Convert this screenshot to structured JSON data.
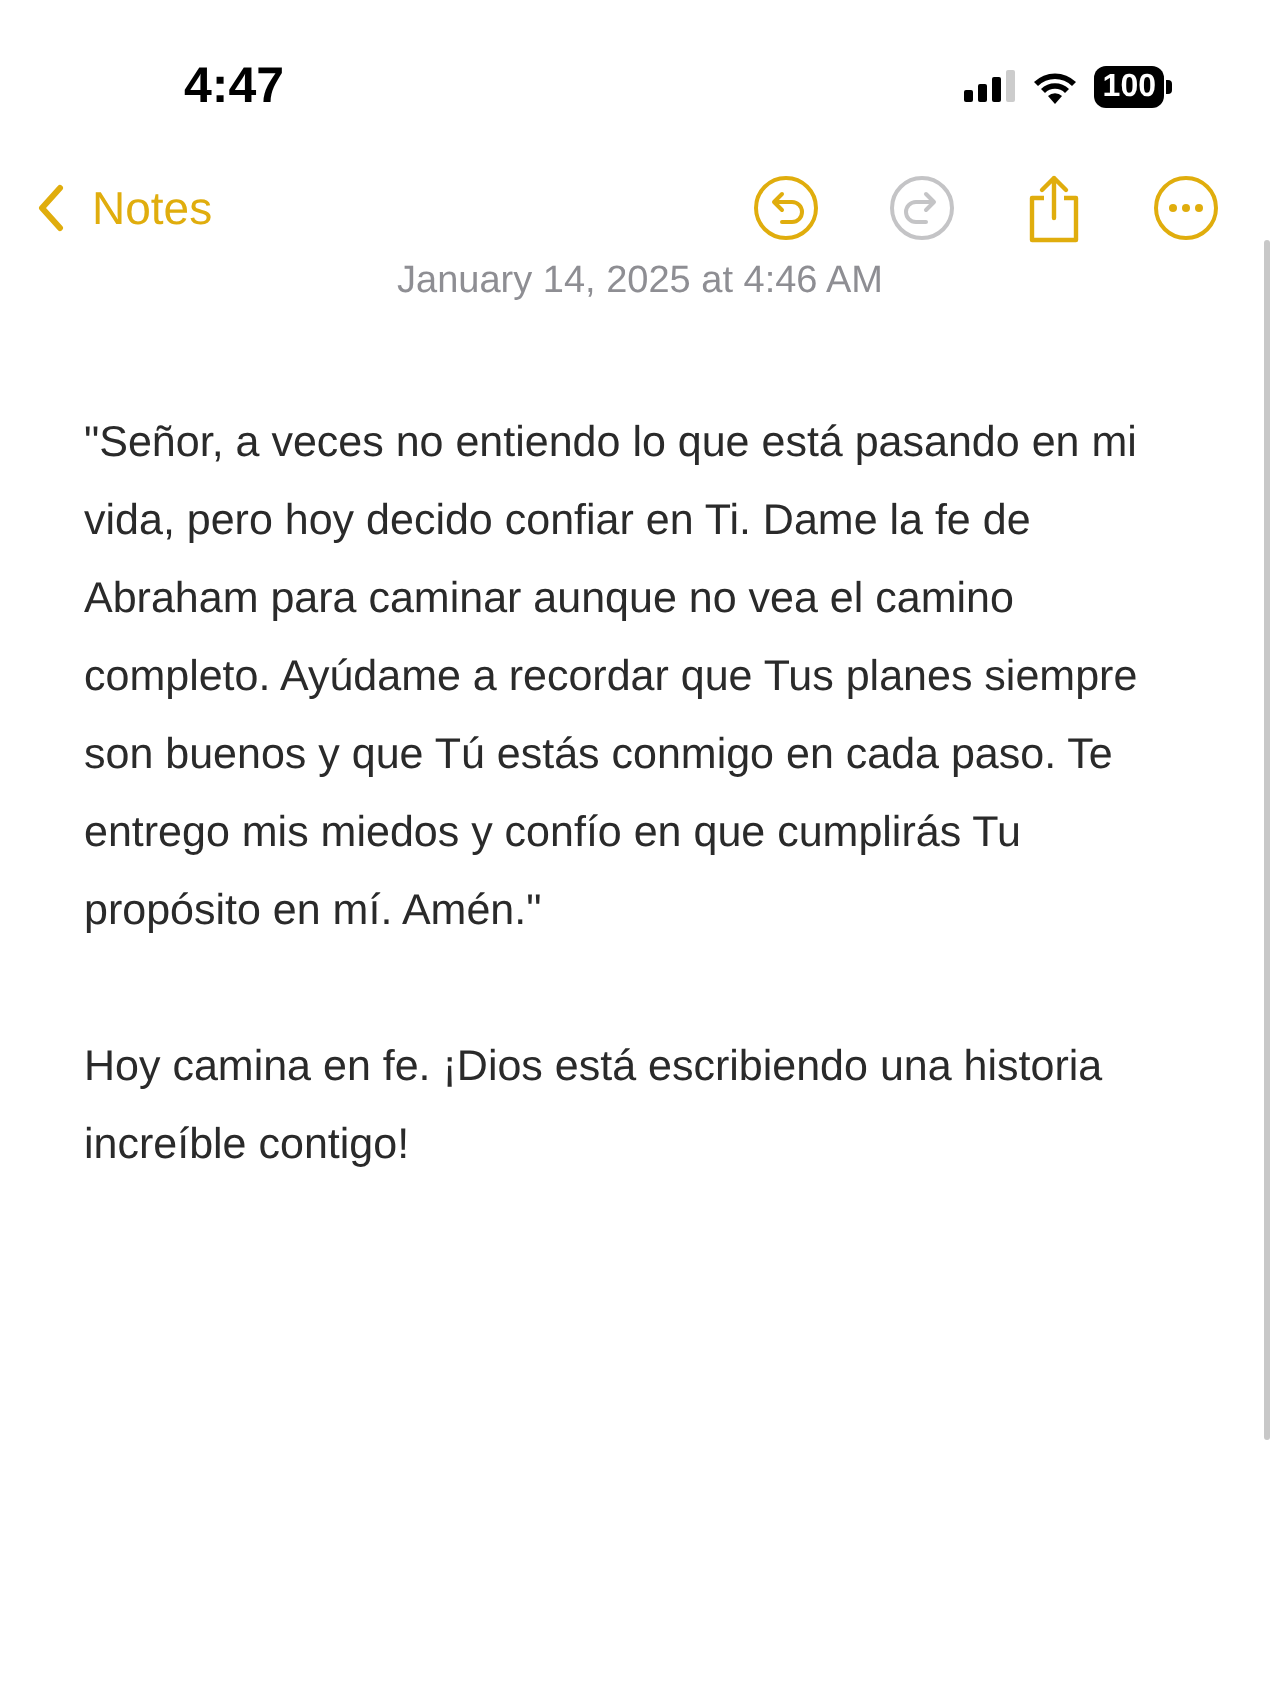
{
  "status_bar": {
    "time": "4:47",
    "battery": "100"
  },
  "nav": {
    "back_label": "Notes",
    "actions": [
      {
        "kind": "undo",
        "disabled": false
      },
      {
        "kind": "redo",
        "disabled": true
      },
      {
        "kind": "share",
        "disabled": false
      },
      {
        "kind": "more",
        "disabled": false
      }
    ]
  },
  "note": {
    "date": "January 14, 2025 at 4:46 AM",
    "paragraphs": [
      "\"Señor, a veces no entiendo lo que está pasando en mi vida, pero hoy decido confiar en Ti. Dame la fe de Abraham para caminar aunque no vea el camino completo. Ayúdame a recordar que Tus planes siempre son buenos y que Tú estás conmigo en cada paso. Te entrego mis miedos y confío en que cumplirás Tu propósito en mí. Amén.\"",
      "Hoy camina en fe. ¡Dios está escribiendo una historia increíble contigo!"
    ]
  }
}
